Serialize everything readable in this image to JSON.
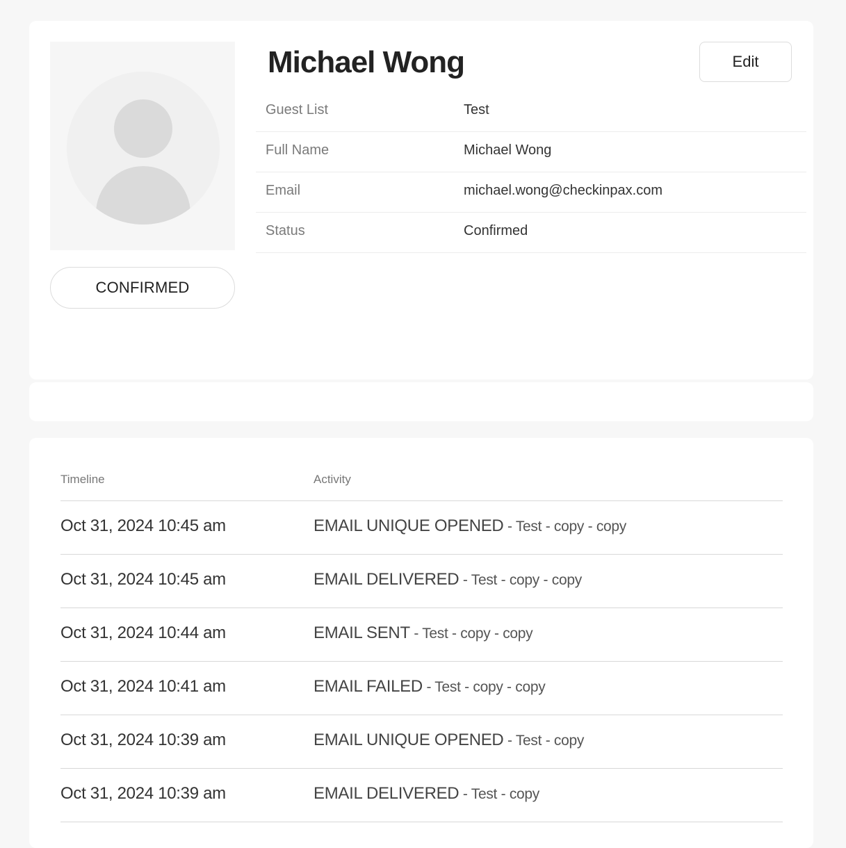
{
  "profile": {
    "name": "Michael Wong",
    "status_badge": "CONFIRMED",
    "edit_label": "Edit",
    "details": [
      {
        "label": "Guest List",
        "value": "Test"
      },
      {
        "label": "Full Name",
        "value": "Michael Wong"
      },
      {
        "label": "Email",
        "value": "michael.wong@checkinpax.com"
      },
      {
        "label": "Status",
        "value": "Confirmed"
      }
    ]
  },
  "timeline": {
    "headers": {
      "time": "Timeline",
      "activity": "Activity"
    },
    "rows": [
      {
        "time": "Oct 31, 2024 10:45 am",
        "event": "EMAIL UNIQUE OPENED",
        "detail": " - Test - copy - copy"
      },
      {
        "time": "Oct 31, 2024 10:45 am",
        "event": "EMAIL DELIVERED",
        "detail": " - Test - copy - copy"
      },
      {
        "time": "Oct 31, 2024 10:44 am",
        "event": "EMAIL SENT",
        "detail": " - Test - copy - copy"
      },
      {
        "time": "Oct 31, 2024 10:41 am",
        "event": "EMAIL FAILED",
        "detail": " - Test - copy - copy"
      },
      {
        "time": "Oct 31, 2024 10:39 am",
        "event": "EMAIL UNIQUE OPENED",
        "detail": " - Test - copy"
      },
      {
        "time": "Oct 31, 2024 10:39 am",
        "event": "EMAIL DELIVERED",
        "detail": " - Test - copy"
      }
    ]
  }
}
